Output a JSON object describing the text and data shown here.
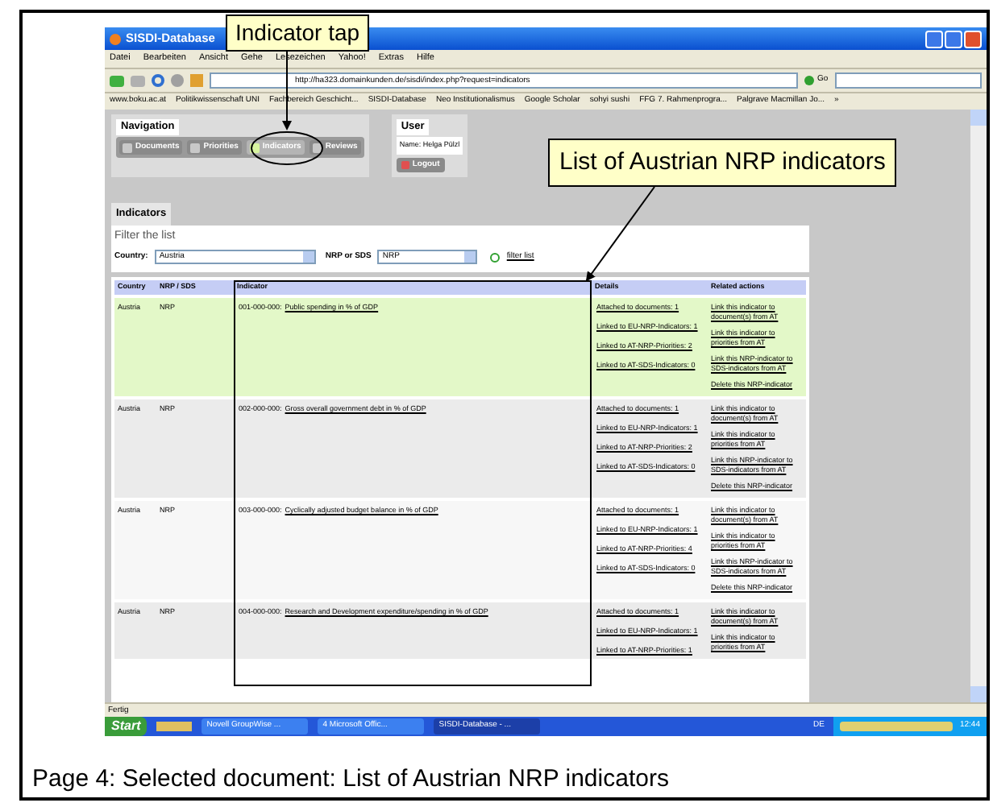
{
  "callouts": [
    {
      "text": "Indicator tap"
    },
    {
      "text": "List of Austrian NRP indicators"
    }
  ],
  "window": {
    "title": "SISDI-Database"
  },
  "menu": [
    "Datei",
    "Bearbeiten",
    "Ansicht",
    "Gehe",
    "Lesezeichen",
    "Yahoo!",
    "Extras",
    "Hilfe"
  ],
  "address": {
    "url": "http://ha323.domainkunden.de/sisdi/index.php?request=indicators",
    "go": "Go"
  },
  "bookmarks": [
    "www.boku.ac.at",
    "Politikwissenschaft UNI",
    "Fachbereich Geschicht...",
    "SISDI-Database",
    "Neo Institutionalismus",
    "Google Scholar",
    "sohyi sushi",
    "FFG 7. Rahmenprogra...",
    "Palgrave Macmillan Jo...",
    "»"
  ],
  "navigation": {
    "title": "Navigation",
    "items": [
      {
        "label": "Documents",
        "selected": false
      },
      {
        "label": "Priorities",
        "selected": false
      },
      {
        "label": "Indicators",
        "selected": true
      },
      {
        "label": "Reviews",
        "selected": false
      }
    ]
  },
  "user": {
    "title": "User",
    "name": "Name: Helga Pülzl",
    "logout": "Logout"
  },
  "tab": "Indicators",
  "filter": {
    "title": "Filter the list",
    "country_label": "Country:",
    "country": "Austria",
    "type_label": "NRP or SDS",
    "type": "NRP",
    "button": "filter list"
  },
  "table": {
    "columns": [
      "Country",
      "NRP / SDS",
      "Indicator",
      "Details",
      "Related actions"
    ],
    "rows": [
      {
        "selected": true,
        "country": "Austria",
        "type": "NRP",
        "code": "001-000-000:",
        "indicator": "Public spending in % of GDP",
        "details": [
          "Attached to documents: 1",
          "Linked to EU-NRP-Indicators: 1",
          "Linked to AT-NRP-Priorities: 2",
          "Linked to AT-SDS-Indicators: 0"
        ],
        "actions": [
          "Link this indicator to document(s) from AT",
          "Link this indicator to priorities from AT",
          "Link this NRP-indicator to SDS-indicators from AT",
          "Delete this NRP-indicator"
        ]
      },
      {
        "selected": false,
        "country": "Austria",
        "type": "NRP",
        "code": "002-000-000:",
        "indicator": "Gross overall government debt in % of GDP",
        "details": [
          "Attached to documents: 1",
          "Linked to EU-NRP-Indicators: 1",
          "Linked to AT-NRP-Priorities: 2",
          "Linked to AT-SDS-Indicators: 0"
        ],
        "actions": [
          "Link this indicator to document(s) from AT",
          "Link this indicator to priorities from AT",
          "Link this NRP-indicator to SDS-indicators from AT",
          "Delete this NRP-indicator"
        ]
      },
      {
        "selected": false,
        "country": "Austria",
        "type": "NRP",
        "code": "003-000-000:",
        "indicator": "Cyclically adjusted budget balance in % of GDP",
        "details": [
          "Attached to documents: 1",
          "Linked to EU-NRP-Indicators: 1",
          "Linked to AT-NRP-Priorities: 4",
          "Linked to AT-SDS-Indicators: 0"
        ],
        "actions": [
          "Link this indicator to document(s) from AT",
          "Link this indicator to priorities from AT",
          "Link this NRP-indicator to SDS-indicators from AT",
          "Delete this NRP-indicator"
        ]
      },
      {
        "selected": false,
        "country": "Austria",
        "type": "NRP",
        "code": "004-000-000:",
        "indicator": "Research and Development expenditure/spending in % of GDP",
        "details": [
          "Attached to documents: 1",
          "Linked to EU-NRP-Indicators: 1",
          "Linked to AT-NRP-Priorities: 1"
        ],
        "actions": [
          "Link this indicator to document(s) from AT",
          "Link this indicator to priorities from AT"
        ]
      }
    ]
  },
  "status_bar": "Fertig",
  "taskbar": {
    "start": "Start",
    "tasks": [
      "Novell GroupWise ...",
      "4 Microsoft Offic...",
      "SISDI-Database - ..."
    ],
    "language": "DE",
    "time": "12:44"
  },
  "caption": "Page 4: Selected document: List of Austrian NRP indicators"
}
